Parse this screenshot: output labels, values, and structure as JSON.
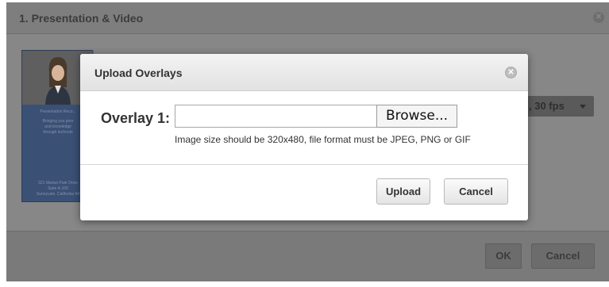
{
  "background_dialog": {
    "title": "1. Presentation & Video",
    "close_glyph": "✕",
    "fps_select": {
      "value": ", 30 fps"
    },
    "thumbnail": {
      "lines": [
        "Presentation Reco...",
        "Bringing you pres",
        "and knowledge",
        "through technolo",
        "321 Market Park Drive",
        "Suite A-100",
        "Sunnyvale, California 94"
      ]
    },
    "ok_label": "OK",
    "cancel_label": "Cancel"
  },
  "modal": {
    "title": "Upload Overlays",
    "close_glyph": "✕",
    "overlay_label": "Overlay 1:",
    "overlay_input": {
      "value": "",
      "placeholder": ""
    },
    "browse_label": "Browse...",
    "hint": "Image size should be 320x480, file format must be JPEG, PNG or GIF",
    "upload_label": "Upload",
    "cancel_label": "Cancel"
  },
  "icons": {
    "close": "close-icon",
    "dropdown": "chevron-down-icon"
  },
  "colors": {
    "overlay_dim": "#878787",
    "modal_header": "#e8e8e8",
    "thumbnail_blue": "#3b5075"
  }
}
